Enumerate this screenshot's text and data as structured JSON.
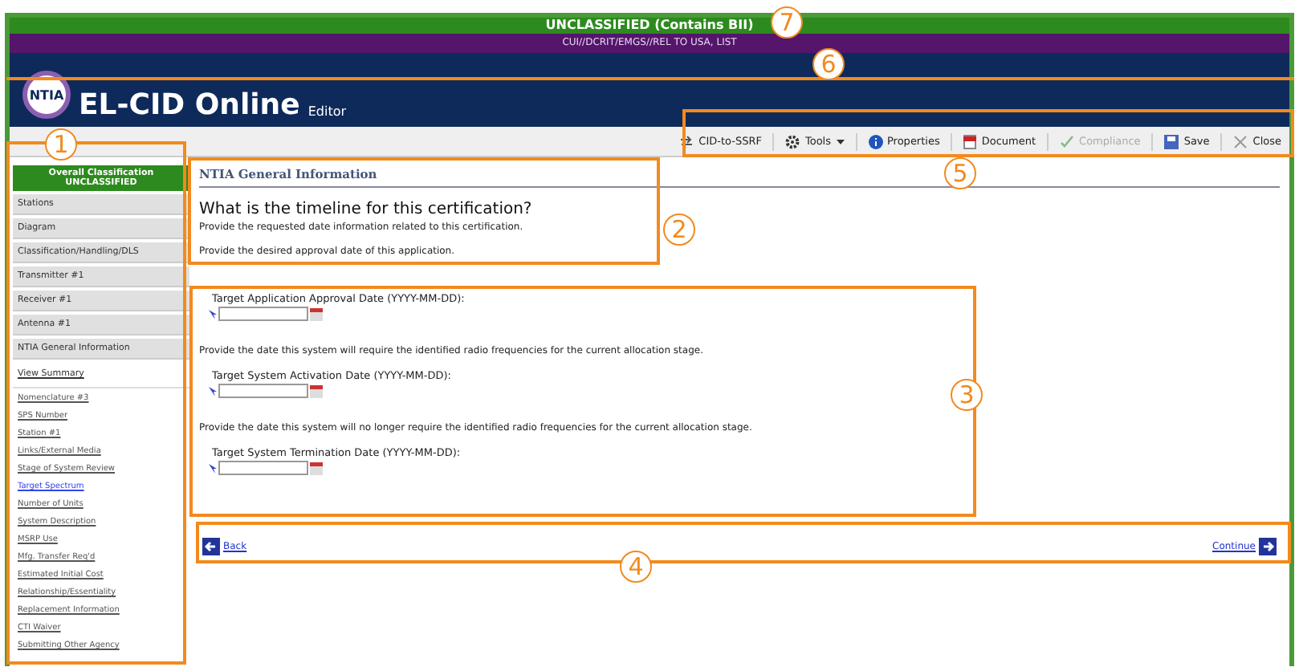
{
  "banner": {
    "classification": "UNCLASSIFIED (Contains BII)",
    "caveat": "CUI//DCRIT/EMGS//REL TO USA, LIST"
  },
  "header": {
    "logo": "NTIA",
    "title": "EL-CID Online",
    "subtitle": "Editor"
  },
  "toolbar": [
    {
      "label": "CID-to-SSRF",
      "disabled": false,
      "dropdown": false
    },
    {
      "label": "Tools",
      "disabled": false,
      "dropdown": true
    },
    {
      "label": "Properties",
      "disabled": false,
      "dropdown": false
    },
    {
      "label": "Document",
      "disabled": false,
      "dropdown": false
    },
    {
      "label": "Compliance",
      "disabled": true,
      "dropdown": false
    },
    {
      "label": "Save",
      "disabled": false,
      "dropdown": false
    },
    {
      "label": "Close",
      "disabled": false,
      "dropdown": false
    }
  ],
  "sidebar": {
    "classification": [
      "Overall Classification",
      "UNCLASSIFIED"
    ],
    "items": [
      {
        "label": "Stations",
        "kind": "tab"
      },
      {
        "label": "Diagram",
        "kind": "tab"
      },
      {
        "label": "Classification/Handling/DLS",
        "kind": "tab"
      },
      {
        "label": "Transmitter #1",
        "kind": "tab"
      },
      {
        "label": "Receiver #1",
        "kind": "tab"
      },
      {
        "label": "Antenna #1",
        "kind": "tab"
      },
      {
        "label": "NTIA General Information",
        "kind": "tab"
      },
      {
        "label": "View Summary",
        "kind": "summary"
      },
      {
        "label": "Nomenclature #3",
        "kind": "link"
      },
      {
        "label": "SPS Number",
        "kind": "link"
      },
      {
        "label": "Station #1",
        "kind": "link"
      },
      {
        "label": "Links/External Media",
        "kind": "link"
      },
      {
        "label": "Stage of System Review",
        "kind": "link"
      },
      {
        "label": "Target Spectrum",
        "kind": "link",
        "visited": false
      },
      {
        "label": "Number of Units",
        "kind": "link"
      },
      {
        "label": "System Description",
        "kind": "link"
      },
      {
        "label": "MSRP Use",
        "kind": "link"
      },
      {
        "label": "Mfg. Transfer Req'd",
        "kind": "link"
      },
      {
        "label": "Estimated Initial Cost",
        "kind": "link"
      },
      {
        "label": "Relationship/Essentiality",
        "kind": "link"
      },
      {
        "label": "Replacement Information",
        "kind": "link"
      },
      {
        "label": "CTI Waiver",
        "kind": "link"
      },
      {
        "label": "Submitting Other Agency",
        "kind": "link"
      }
    ]
  },
  "content": {
    "section": "NTIA General Information",
    "question": "What is the timeline for this certification?",
    "intro": [
      "Provide the requested date information related to this certification.",
      "Provide the desired approval date of this application."
    ],
    "fields": [
      {
        "label": "Target Application Approval Date (YYYY-MM-DD):"
      },
      {
        "description": "Provide the date this system will require the identified radio frequencies for the current allocation stage.",
        "label": "Target System Activation Date (YYYY-MM-DD):"
      },
      {
        "description": "Provide the date this system will no longer require the identified radio frequencies for the current allocation stage.",
        "label": "Target System Termination Date (YYYY-MM-DD):"
      }
    ],
    "back": "Back",
    "continue": "Continue"
  },
  "callouts": [
    "1",
    "2",
    "3",
    "4",
    "5",
    "6",
    "7"
  ]
}
